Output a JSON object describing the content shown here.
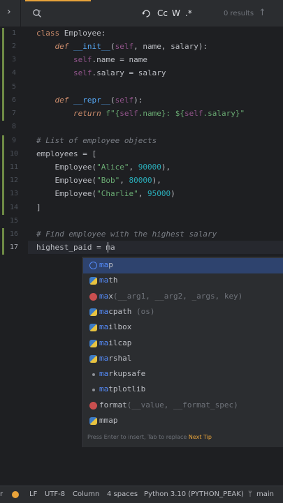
{
  "findbar": {
    "search_value": "",
    "option_case": "Cc",
    "option_word": "W",
    "option_regex": ".*",
    "results": "0 results"
  },
  "editor": {
    "line_numbers": [
      "1",
      "2",
      "3",
      "4",
      "5",
      "6",
      "7",
      "8",
      "9",
      "10",
      "11",
      "12",
      "13",
      "14",
      "15",
      "16",
      "17"
    ],
    "current_line": "17"
  },
  "completion": {
    "items": [
      {
        "match": "ma",
        "rest": "p",
        "hint": "",
        "icon": "class"
      },
      {
        "match": "ma",
        "rest": "th",
        "hint": "",
        "icon": "python-module"
      },
      {
        "match": "ma",
        "rest": "x",
        "hint": "(__arg1, __arg2, _args, key)",
        "icon": "function"
      },
      {
        "match": "ma",
        "rest": "cpath",
        "hint": " (os)",
        "icon": "python-module"
      },
      {
        "match": "ma",
        "rest": "ilbox",
        "hint": "",
        "icon": "python-module"
      },
      {
        "match": "ma",
        "rest": "ilcap",
        "hint": "",
        "icon": "python-module"
      },
      {
        "match": "ma",
        "rest": "rshal",
        "hint": "",
        "icon": "python-module"
      },
      {
        "match": "ma",
        "rest": "rkupsafe",
        "hint": "",
        "icon": "package"
      },
      {
        "match": "ma",
        "rest": "tplotlib",
        "hint": "",
        "icon": "package"
      },
      {
        "match": "",
        "rest": "format",
        "hint": "(__value, __format_spec)",
        "icon": "function"
      },
      {
        "match": "",
        "rest": "mmap",
        "hint": "",
        "icon": "python-module"
      }
    ],
    "footer": "Press Enter to insert, Tab to replace",
    "next_tip": "Next Tip"
  },
  "statusbar": {
    "partial_left": "r",
    "line_ending": "LF",
    "encoding": "UTF-8",
    "column_mode": "Column",
    "indent": "4 spaces",
    "interpreter": "Python 3.10 (PYTHON_PEAK)",
    "branch": "main"
  }
}
